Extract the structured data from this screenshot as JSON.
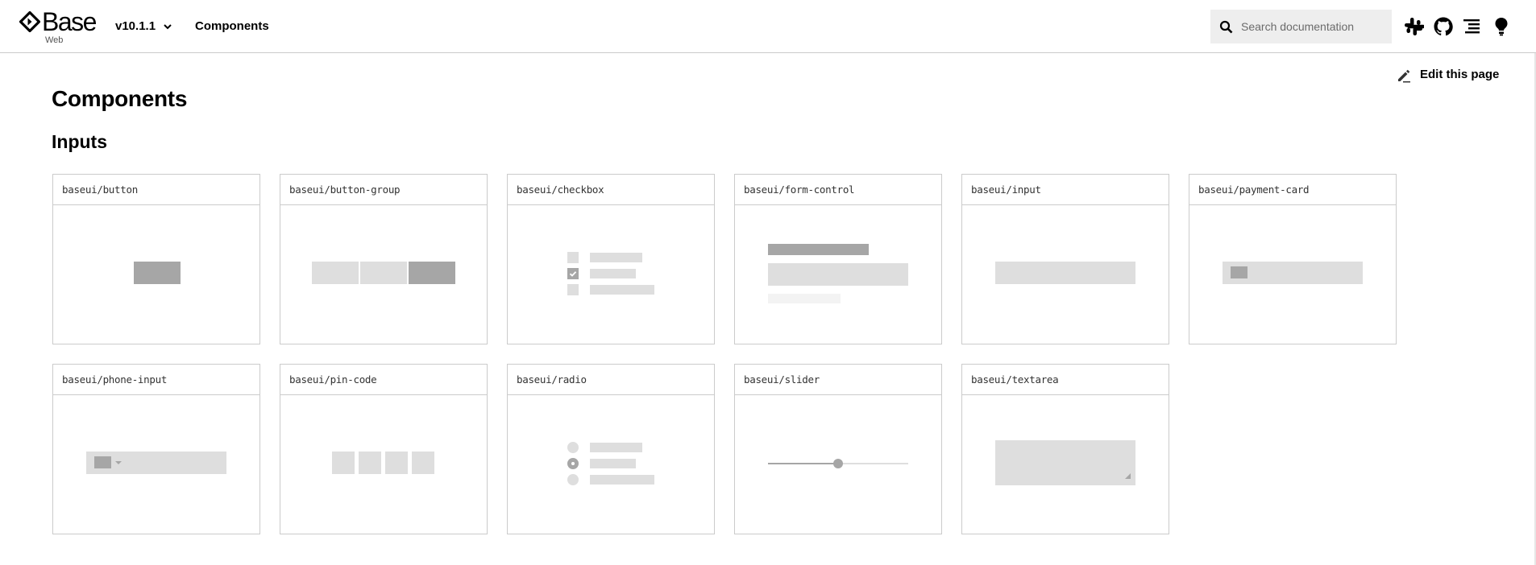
{
  "header": {
    "logo_text": "Base",
    "logo_subtext": "Web",
    "version": "v10.1.1",
    "nav_link": "Components",
    "search_placeholder": "Search documentation",
    "icons": [
      "slack-icon",
      "github-icon",
      "text-direction-icon",
      "theme-lightbulb-icon"
    ]
  },
  "edit_link": "Edit this page",
  "page_title": "Components",
  "section_title": "Inputs",
  "cards": [
    {
      "name": "baseui/button"
    },
    {
      "name": "baseui/button-group"
    },
    {
      "name": "baseui/checkbox"
    },
    {
      "name": "baseui/form-control"
    },
    {
      "name": "baseui/input"
    },
    {
      "name": "baseui/payment-card"
    },
    {
      "name": "baseui/phone-input"
    },
    {
      "name": "baseui/pin-code"
    },
    {
      "name": "baseui/radio"
    },
    {
      "name": "baseui/slider"
    },
    {
      "name": "baseui/textarea"
    }
  ],
  "previews": {
    "checkbox_checked_index": 1,
    "radio_selected_index": 1,
    "slider_value_fraction": 0.5,
    "button_group_selected_index": 2,
    "pin_code_digits": 4
  },
  "colors": {
    "placeholder_dark": "#a6a6a6",
    "placeholder_light": "#dedede",
    "border": "#cbcbcb",
    "search_bg": "#eeeeee"
  }
}
